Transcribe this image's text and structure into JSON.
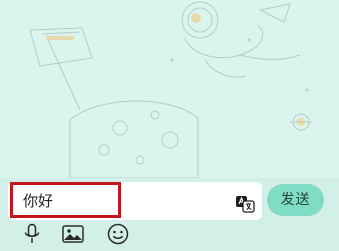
{
  "composer": {
    "input_value": "你好",
    "send_label": "发送"
  },
  "icons": {
    "translate": "translate-icon",
    "voice": "microphone-icon",
    "image": "image-icon",
    "emoji": "smiley-icon"
  },
  "colors": {
    "chat_background": "#dcf4ee",
    "composer_background": "#d2efe8",
    "send_button": "#7fdcc5",
    "highlight_border": "#c4161c"
  }
}
